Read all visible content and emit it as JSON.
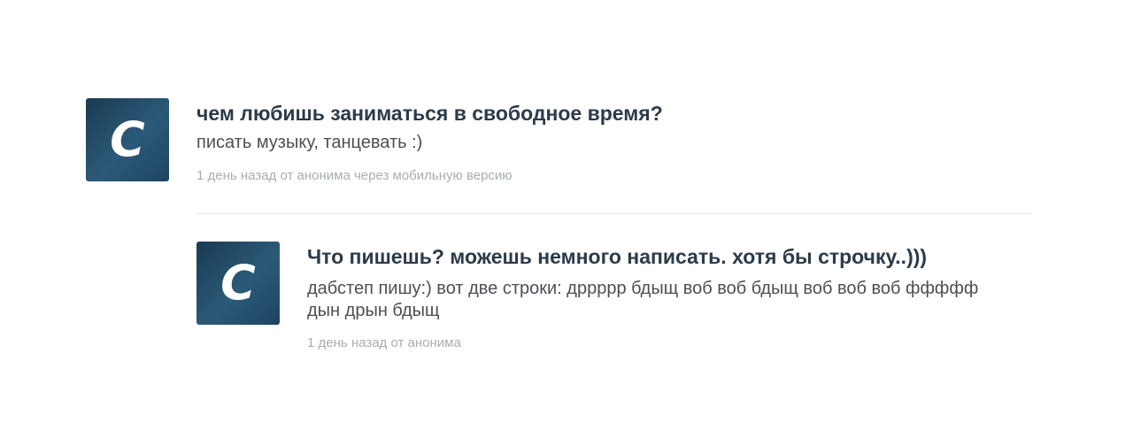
{
  "items": [
    {
      "avatar_letter": "C",
      "question": "чем любишь заниматься в свободное время?",
      "answer": "писать музыку, танцевать :)",
      "meta": "1 день назад от анонима через мобильную версию"
    },
    {
      "avatar_letter": "C",
      "question": "Что пишешь? можешь немного написать. хотя бы строчку..)))",
      "answer": "дабстеп пишу:) вот две строки: дррррр бдыщ воб воб бдыщ воб воб воб ффффф дын дрын бдыщ",
      "meta": "1 день назад от анонима"
    }
  ]
}
